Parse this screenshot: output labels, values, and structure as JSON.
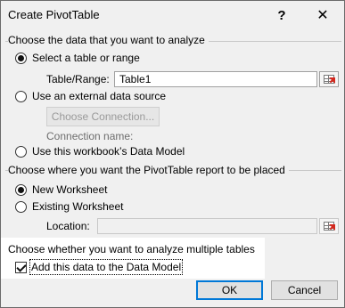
{
  "window": {
    "title": "Create PivotTable",
    "help_label": "?",
    "close_label": "✕"
  },
  "source_section": {
    "label": "Choose the data that you want to analyze",
    "options": [
      {
        "label": "Select a table or range",
        "selected": true
      },
      {
        "label": "Use an external data source",
        "selected": false
      },
      {
        "label": "Use this workbook’s Data Model",
        "selected": false
      }
    ],
    "table_range_label": "Table/Range:",
    "table_range_value": "Table1",
    "choose_connection_label": "Choose Connection...",
    "connection_name_label": "Connection name:"
  },
  "placement_section": {
    "label": "Choose where you want the PivotTable report to be placed",
    "options": [
      {
        "label": "New Worksheet",
        "selected": true
      },
      {
        "label": "Existing Worksheet",
        "selected": false
      }
    ],
    "location_label": "Location:",
    "location_value": ""
  },
  "multiple_tables_section": {
    "label": "Choose whether you want to analyze multiple tables",
    "add_to_data_model_label": "Add this data to the Data Model",
    "add_to_data_model_checked": true
  },
  "buttons": {
    "ok_label": "OK",
    "cancel_label": "Cancel"
  },
  "icons": {
    "range_selector": "range-selector-icon",
    "help": "help-icon",
    "close": "close-icon"
  }
}
